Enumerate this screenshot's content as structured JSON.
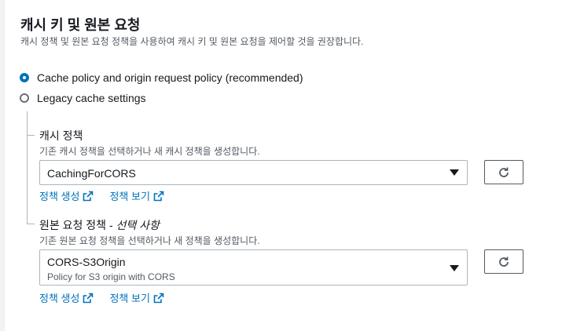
{
  "header": {
    "title": "캐시 키 및 원본 요청",
    "subtitle": "캐시 정책 및 원본 요청 정책을 사용하여 캐시 키 및 원본 요청을 제어할 것을 권장합니다."
  },
  "options": [
    {
      "label": "Cache policy and origin request policy (recommended)",
      "selected": true
    },
    {
      "label": "Legacy cache settings",
      "selected": false
    }
  ],
  "cache_policy": {
    "label": "캐시 정책",
    "description": "기존 캐시 정책을 선택하거나 새 캐시 정책을 생성합니다.",
    "selected_value": "CachingForCORS",
    "create_link": "정책 생성",
    "view_link": "정책 보기"
  },
  "origin_policy": {
    "label": "원본 요청 정책 - ",
    "label_optional": "선택 사항",
    "description": "기존 원본 요청 정책을 선택하거나 새 정책을 생성합니다.",
    "selected_value": "CORS-S3Origin",
    "selected_desc": "Policy for S3 origin with CORS",
    "create_link": "정책 생성",
    "view_link": "정책 보기"
  },
  "colors": {
    "accent": "#0073bb",
    "text": "#16191f",
    "muted": "#545b64",
    "border": "#aab7b8"
  },
  "icons": {
    "refresh": "refresh-icon",
    "external": "external-link-icon",
    "caret": "caret-down-icon"
  }
}
